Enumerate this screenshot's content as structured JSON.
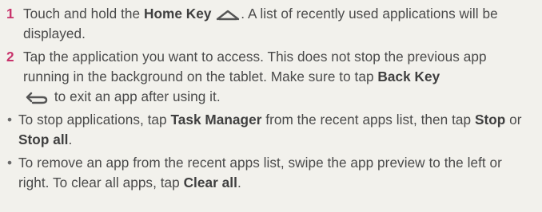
{
  "step1": {
    "number": "1",
    "text_a": "Touch and hold the ",
    "key_label": "Home Key",
    "home_icon": "home-key-icon",
    "text_b": ". A list of recently used applications will be displayed."
  },
  "step2": {
    "number": "2",
    "text_a": "Tap the application you want to access. This does not stop the previous app running in the background on the tablet. Make sure to tap ",
    "key_label": "Back Key",
    "back_icon": "back-key-icon",
    "text_b": " to exit an app after using it."
  },
  "bullet1": {
    "marker": "•",
    "text_a": "To stop applications, tap ",
    "task_manager": "Task Manager",
    "text_b": " from the recent apps list, then tap ",
    "stop": "Stop",
    "text_c": " or ",
    "stop_all": "Stop all",
    "text_d": "."
  },
  "bullet2": {
    "marker": "•",
    "text_a": "To remove an app from the recent apps list, swipe the app preview to the left or right. To clear all apps, tap ",
    "clear_all": "Clear all",
    "text_b": "."
  },
  "colors": {
    "step_number": "#c8336b",
    "body_text": "#4a4a4a",
    "background": "#f2f1ec"
  }
}
